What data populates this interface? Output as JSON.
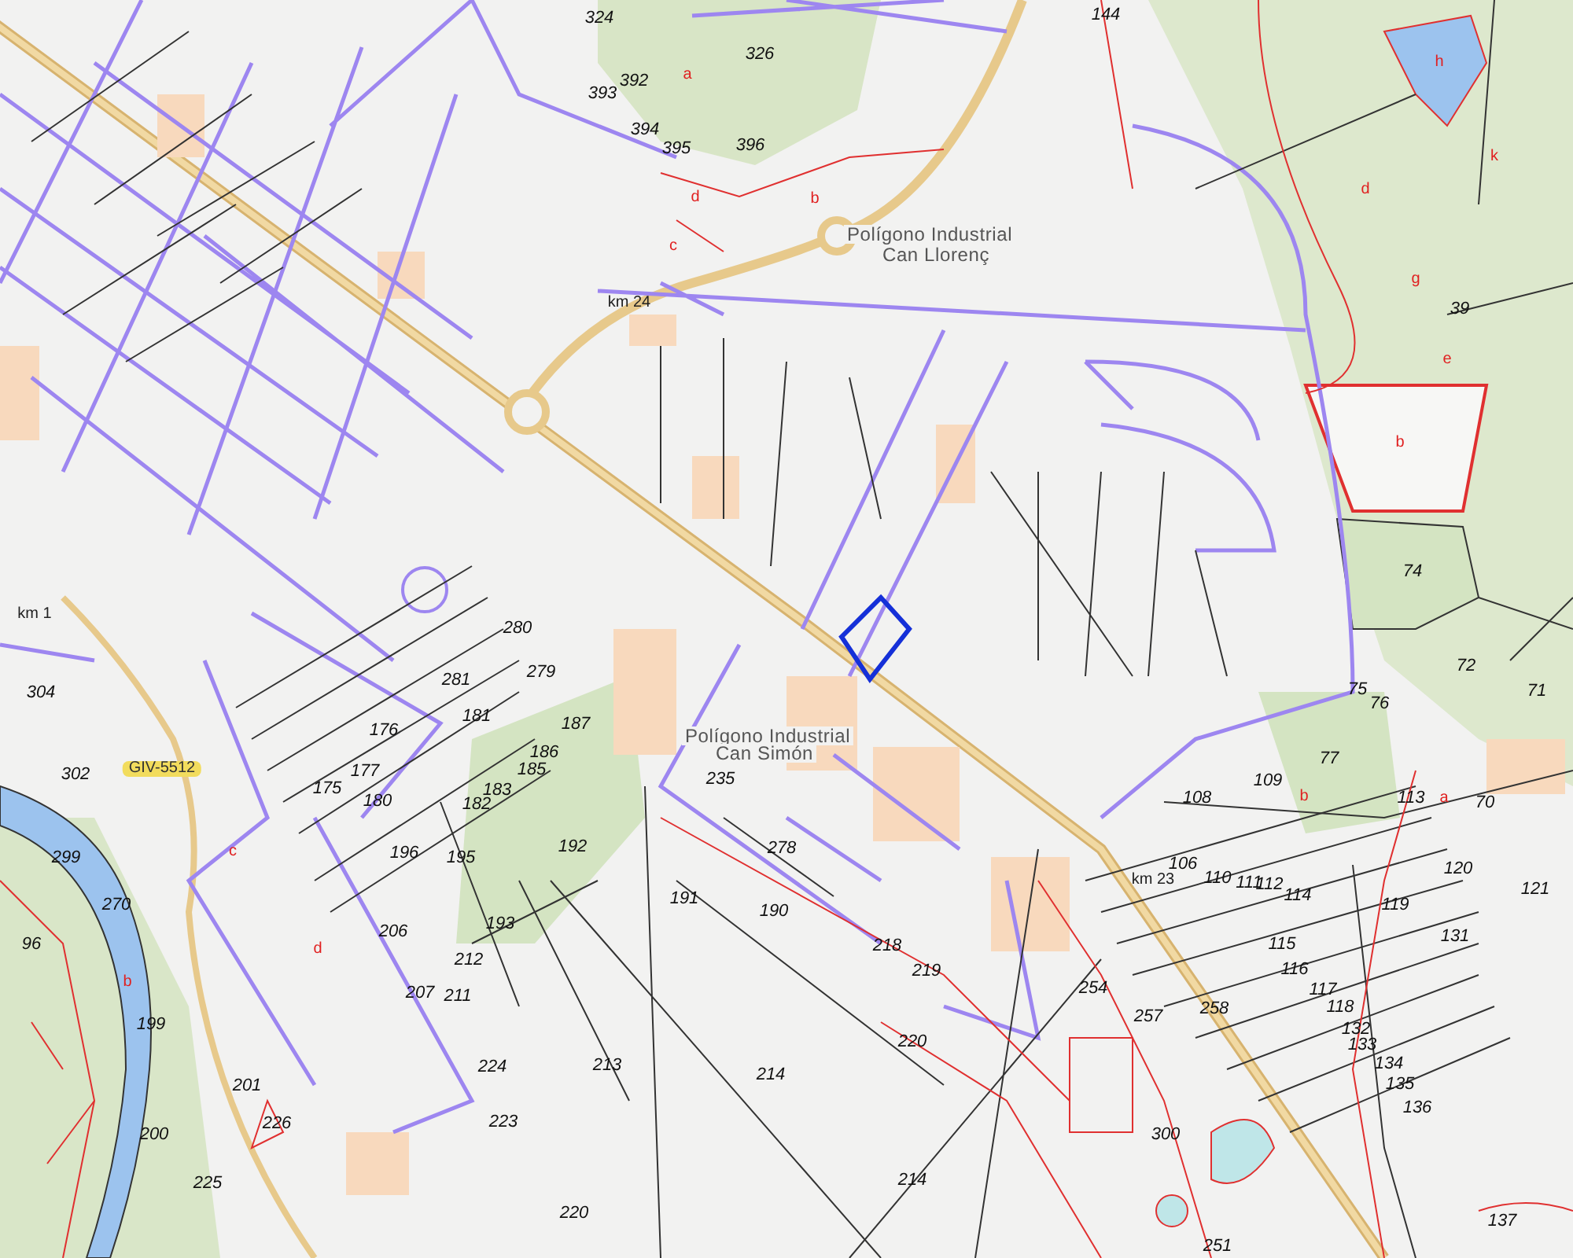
{
  "map": {
    "selected_parcel": true,
    "labels": [
      {
        "kind": "place",
        "text": "Polígono Industrial"
      },
      {
        "kind": "place",
        "text": "Can Llorenç"
      },
      {
        "kind": "place",
        "text": "Polígono Industrial"
      },
      {
        "kind": "place",
        "text": "Can Simón"
      },
      {
        "kind": "road",
        "text": "GIV-5512"
      },
      {
        "kind": "km",
        "text": "km 24"
      },
      {
        "kind": "km",
        "text": "km 23"
      },
      {
        "kind": "km",
        "text": "km 1"
      },
      {
        "kind": "parcel",
        "text": "324"
      },
      {
        "kind": "parcel",
        "text": "326"
      },
      {
        "kind": "parcel",
        "text": "392"
      },
      {
        "kind": "parcel",
        "text": "393"
      },
      {
        "kind": "parcel",
        "text": "394"
      },
      {
        "kind": "parcel",
        "text": "395"
      },
      {
        "kind": "parcel",
        "text": "396"
      },
      {
        "kind": "parcel",
        "text": "144"
      },
      {
        "kind": "parcel",
        "text": "39"
      },
      {
        "kind": "parcel",
        "text": "74"
      },
      {
        "kind": "parcel",
        "text": "72"
      },
      {
        "kind": "parcel",
        "text": "75"
      },
      {
        "kind": "parcel",
        "text": "71"
      },
      {
        "kind": "parcel",
        "text": "76"
      },
      {
        "kind": "parcel",
        "text": "77"
      },
      {
        "kind": "parcel",
        "text": "109"
      },
      {
        "kind": "parcel",
        "text": "113"
      },
      {
        "kind": "parcel",
        "text": "70"
      },
      {
        "kind": "parcel",
        "text": "120"
      },
      {
        "kind": "parcel",
        "text": "121"
      },
      {
        "kind": "parcel",
        "text": "108"
      },
      {
        "kind": "parcel",
        "text": "106"
      },
      {
        "kind": "parcel",
        "text": "110"
      },
      {
        "kind": "parcel",
        "text": "111"
      },
      {
        "kind": "parcel",
        "text": "112"
      },
      {
        "kind": "parcel",
        "text": "114"
      },
      {
        "kind": "parcel",
        "text": "119"
      },
      {
        "kind": "parcel",
        "text": "131"
      },
      {
        "kind": "parcel",
        "text": "115"
      },
      {
        "kind": "parcel",
        "text": "116"
      },
      {
        "kind": "parcel",
        "text": "117"
      },
      {
        "kind": "parcel",
        "text": "118"
      },
      {
        "kind": "parcel",
        "text": "132"
      },
      {
        "kind": "parcel",
        "text": "133"
      },
      {
        "kind": "parcel",
        "text": "134"
      },
      {
        "kind": "parcel",
        "text": "135"
      },
      {
        "kind": "parcel",
        "text": "136"
      },
      {
        "kind": "parcel",
        "text": "254"
      },
      {
        "kind": "parcel",
        "text": "257"
      },
      {
        "kind": "parcel",
        "text": "258"
      },
      {
        "kind": "parcel",
        "text": "300"
      },
      {
        "kind": "parcel",
        "text": "251"
      },
      {
        "kind": "parcel",
        "text": "137"
      },
      {
        "kind": "parcel",
        "text": "280"
      },
      {
        "kind": "parcel",
        "text": "281"
      },
      {
        "kind": "parcel",
        "text": "279"
      },
      {
        "kind": "parcel",
        "text": "181"
      },
      {
        "kind": "parcel",
        "text": "187"
      },
      {
        "kind": "parcel",
        "text": "186"
      },
      {
        "kind": "parcel",
        "text": "185"
      },
      {
        "kind": "parcel",
        "text": "183"
      },
      {
        "kind": "parcel",
        "text": "182"
      },
      {
        "kind": "parcel",
        "text": "176"
      },
      {
        "kind": "parcel",
        "text": "175"
      },
      {
        "kind": "parcel",
        "text": "177"
      },
      {
        "kind": "parcel",
        "text": "180"
      },
      {
        "kind": "parcel",
        "text": "196"
      },
      {
        "kind": "parcel",
        "text": "195"
      },
      {
        "kind": "parcel",
        "text": "206"
      },
      {
        "kind": "parcel",
        "text": "193"
      },
      {
        "kind": "parcel",
        "text": "212"
      },
      {
        "kind": "parcel",
        "text": "207"
      },
      {
        "kind": "parcel",
        "text": "211"
      },
      {
        "kind": "parcel",
        "text": "224"
      },
      {
        "kind": "parcel",
        "text": "223"
      },
      {
        "kind": "parcel",
        "text": "302"
      },
      {
        "kind": "parcel",
        "text": "304"
      },
      {
        "kind": "parcel",
        "text": "299"
      },
      {
        "kind": "parcel",
        "text": "270"
      },
      {
        "kind": "parcel",
        "text": "96"
      },
      {
        "kind": "parcel",
        "text": "199"
      },
      {
        "kind": "parcel",
        "text": "201"
      },
      {
        "kind": "parcel",
        "text": "200"
      },
      {
        "kind": "parcel",
        "text": "225"
      },
      {
        "kind": "parcel",
        "text": "226"
      },
      {
        "kind": "parcel",
        "text": "192"
      },
      {
        "kind": "parcel",
        "text": "191"
      },
      {
        "kind": "parcel",
        "text": "278"
      },
      {
        "kind": "parcel",
        "text": "190"
      },
      {
        "kind": "parcel",
        "text": "235"
      },
      {
        "kind": "parcel",
        "text": "218"
      },
      {
        "kind": "parcel",
        "text": "219"
      },
      {
        "kind": "parcel",
        "text": "220"
      },
      {
        "kind": "parcel",
        "text": "213"
      },
      {
        "kind": "parcel",
        "text": "214"
      },
      {
        "kind": "parcel",
        "text": "214"
      },
      {
        "kind": "parcel",
        "text": "220"
      },
      {
        "kind": "subparcel",
        "text": "h"
      },
      {
        "kind": "subparcel",
        "text": "k"
      },
      {
        "kind": "subparcel",
        "text": "g"
      },
      {
        "kind": "subparcel",
        "text": "e"
      },
      {
        "kind": "subparcel",
        "text": "b"
      },
      {
        "kind": "subparcel",
        "text": "d"
      },
      {
        "kind": "subparcel",
        "text": "a"
      },
      {
        "kind": "subparcel",
        "text": "b"
      },
      {
        "kind": "subparcel",
        "text": "d"
      },
      {
        "kind": "subparcel",
        "text": "c"
      },
      {
        "kind": "subparcel",
        "text": "b"
      },
      {
        "kind": "subparcel",
        "text": "a"
      },
      {
        "kind": "subparcel",
        "text": "b"
      },
      {
        "kind": "subparcel",
        "text": "c"
      },
      {
        "kind": "subparcel",
        "text": "d"
      }
    ]
  }
}
